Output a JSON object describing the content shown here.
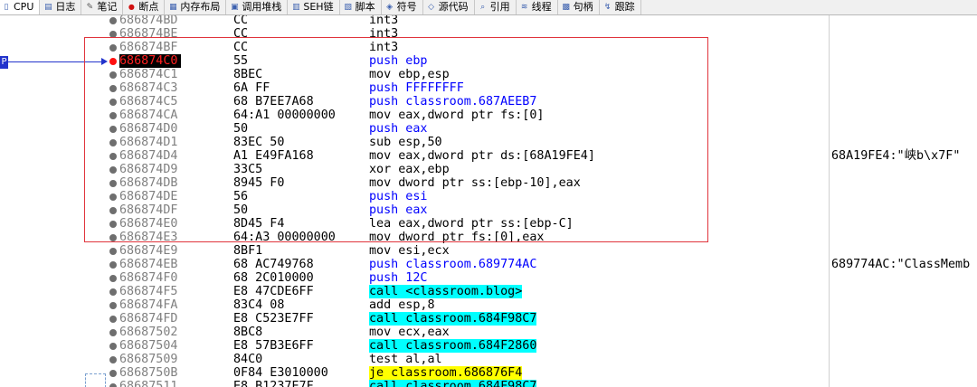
{
  "tabs": [
    {
      "label": "CPU",
      "icon": "cpu-icon",
      "active": true
    },
    {
      "label": "日志",
      "icon": "log-icon"
    },
    {
      "label": "笔记",
      "icon": "notes-icon"
    },
    {
      "label": "断点",
      "icon": "breakpoint-icon"
    },
    {
      "label": "内存布局",
      "icon": "memory-map-icon"
    },
    {
      "label": "调用堆栈",
      "icon": "call-stack-icon"
    },
    {
      "label": "SEH链",
      "icon": "seh-icon"
    },
    {
      "label": "脚本",
      "icon": "script-icon"
    },
    {
      "label": "符号",
      "icon": "symbols-icon"
    },
    {
      "label": "源代码",
      "icon": "source-icon"
    },
    {
      "label": "引用",
      "icon": "references-icon"
    },
    {
      "label": "线程",
      "icon": "threads-icon"
    },
    {
      "label": "句柄",
      "icon": "handles-icon"
    },
    {
      "label": "跟踪",
      "icon": "trace-icon"
    }
  ],
  "eip_marker": "P",
  "colors": {
    "red_box": "#e0343c",
    "current_addr_bg": "#000000",
    "current_addr_fg": "#ff2020",
    "eip_blue": "#2233cc",
    "call_highlight": "#00ffff",
    "jump_highlight": "#ffff00"
  },
  "rows": [
    {
      "addr": "686874BD",
      "bytes": "CC",
      "asm": "int3"
    },
    {
      "addr": "686874BE",
      "bytes": "CC",
      "asm": "int3"
    },
    {
      "addr": "686874BF",
      "bytes": "CC",
      "asm": "int3"
    },
    {
      "addr": "686874C0",
      "bytes": "55",
      "asm": "push ebp",
      "current": true
    },
    {
      "addr": "686874C1",
      "bytes": "8BEC",
      "asm": "mov ebp,esp"
    },
    {
      "addr": "686874C3",
      "bytes": "6A FF",
      "asm": "push FFFFFFFF"
    },
    {
      "addr": "686874C5",
      "bytes": "68 B7EE7A68",
      "asm": "push classroom.687AEEB7"
    },
    {
      "addr": "686874CA",
      "bytes": "64:A1 00000000",
      "asm": "mov eax,dword ptr fs:[0]"
    },
    {
      "addr": "686874D0",
      "bytes": "50",
      "asm": "push eax"
    },
    {
      "addr": "686874D1",
      "bytes": "83EC 50",
      "asm": "sub esp,50"
    },
    {
      "addr": "686874D4",
      "bytes": "A1 E49FA168",
      "asm": "mov eax,dword ptr ds:[68A19FE4]",
      "comment": "68A19FE4:\"峡b\\x7F\""
    },
    {
      "addr": "686874D9",
      "bytes": "33C5",
      "asm": "xor eax,ebp"
    },
    {
      "addr": "686874DB",
      "bytes": "8945 F0",
      "asm": "mov dword ptr ss:[ebp-10],eax"
    },
    {
      "addr": "686874DE",
      "bytes": "56",
      "asm": "push esi"
    },
    {
      "addr": "686874DF",
      "bytes": "50",
      "asm": "push eax"
    },
    {
      "addr": "686874E0",
      "bytes": "8D45 F4",
      "asm": "lea eax,dword ptr ss:[ebp-C]"
    },
    {
      "addr": "686874E3",
      "bytes": "64:A3 00000000",
      "asm": "mov dword ptr fs:[0],eax"
    },
    {
      "addr": "686874E9",
      "bytes": "8BF1",
      "asm": "mov esi,ecx"
    },
    {
      "addr": "686874EB",
      "bytes": "68 AC749768",
      "asm": "push classroom.689774AC",
      "comment": "689774AC:\"ClassMemb"
    },
    {
      "addr": "686874F0",
      "bytes": "68 2C010000",
      "asm": "push 12C"
    },
    {
      "addr": "686874F5",
      "bytes": "E8 47CDE6FF",
      "asm": "call <classroom.blog>"
    },
    {
      "addr": "686874FA",
      "bytes": "83C4 08",
      "asm": "add esp,8"
    },
    {
      "addr": "686874FD",
      "bytes": "E8 C523E7FF",
      "asm": "call classroom.684F98C7"
    },
    {
      "addr": "68687502",
      "bytes": "8BC8",
      "asm": "mov ecx,eax"
    },
    {
      "addr": "68687504",
      "bytes": "E8 57B3E6FF",
      "asm": "call classroom.684F2860"
    },
    {
      "addr": "68687509",
      "bytes": "84C0",
      "asm": "test al,al"
    },
    {
      "addr": "6868750B",
      "bytes": "0F84 E3010000",
      "asm": "je classroom.686876F4"
    },
    {
      "addr": "68687511",
      "bytes": "E8 B1237E7F",
      "asm": "call classroom.684F98C7"
    }
  ]
}
